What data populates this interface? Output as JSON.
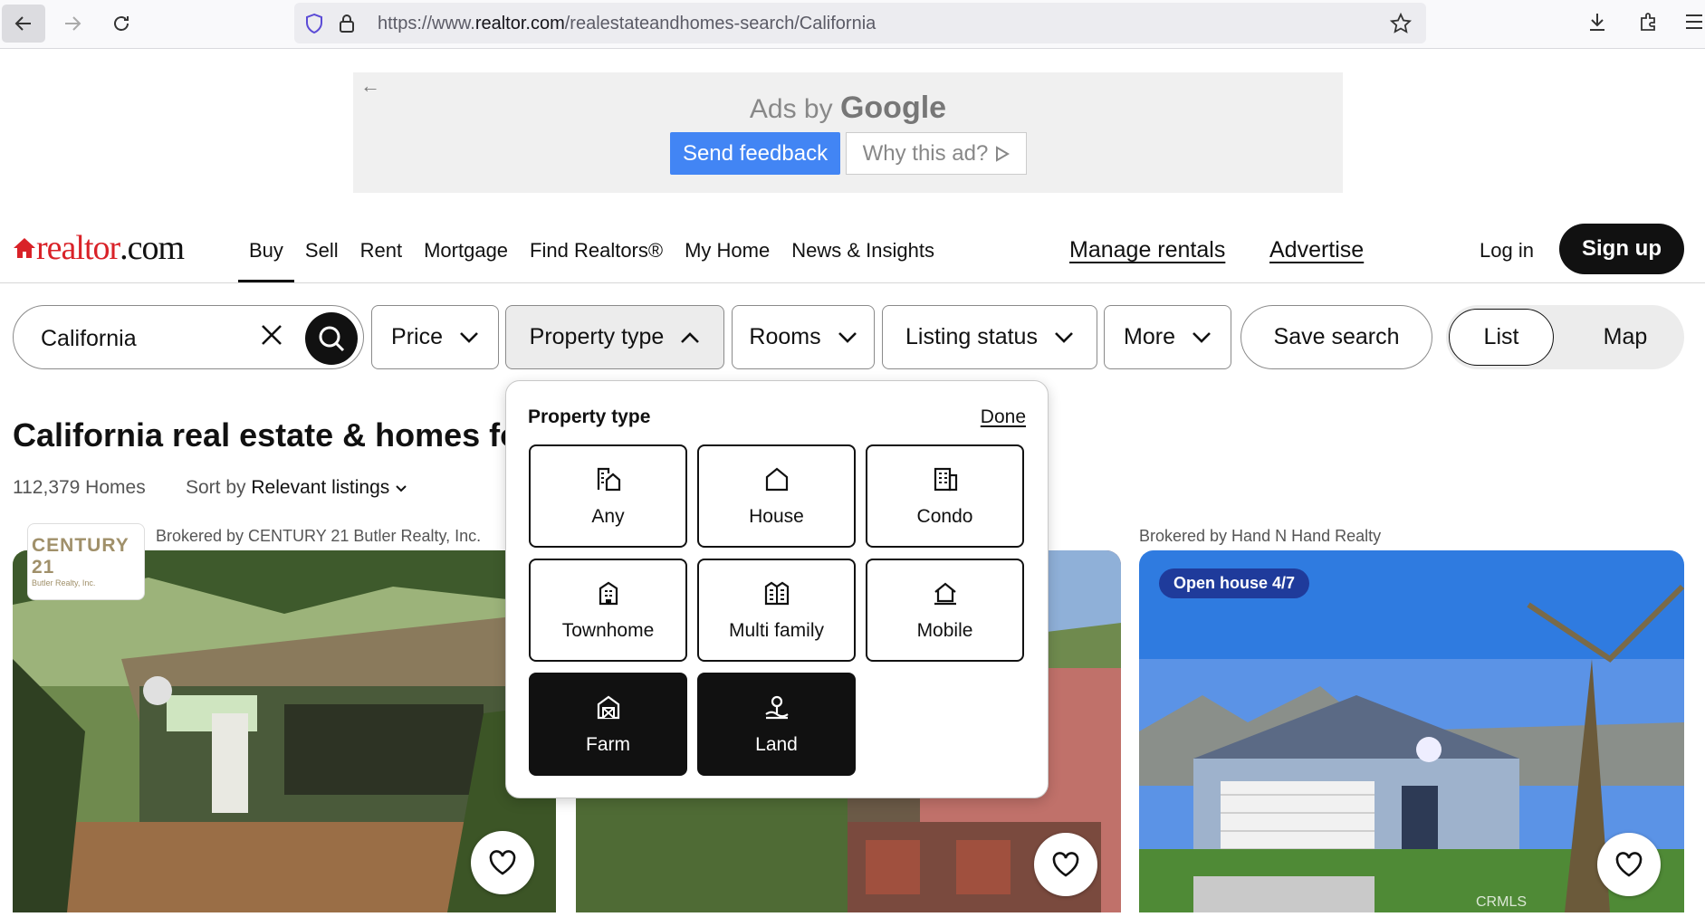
{
  "browser": {
    "url_prefix": "https://www.",
    "url_domain": "realtor.com",
    "url_path": "/realestateandhomes-search/California"
  },
  "ad": {
    "ads_by": "Ads by",
    "google": "Google",
    "feedback": "Send feedback",
    "why": "Why this ad?"
  },
  "header": {
    "logo_main": "realtor",
    "logo_com": ".com",
    "nav": [
      {
        "label": "Buy"
      },
      {
        "label": "Sell"
      },
      {
        "label": "Rent"
      },
      {
        "label": "Mortgage"
      },
      {
        "label": "Find Realtors®"
      },
      {
        "label": "My Home"
      },
      {
        "label": "News & Insights"
      }
    ],
    "manage_rentals": "Manage rentals",
    "advertise": "Advertise",
    "login": "Log in",
    "signup": "Sign up"
  },
  "filters": {
    "search_value": "California",
    "price": "Price",
    "property_type": "Property type",
    "rooms": "Rooms",
    "listing_status": "Listing status",
    "more": "More",
    "save_search": "Save search",
    "list": "List",
    "map": "Map"
  },
  "results": {
    "title": "California real estate & homes for sale",
    "count": "112,379 Homes",
    "sort_prefix": "Sort by",
    "sort_value": "Relevant listings"
  },
  "cards": [
    {
      "broker": "Brokered by CENTURY 21 Butler Realty, Inc.",
      "brand": "CENTURY 21",
      "brand_sub": "Butler Realty, Inc."
    },
    {
      "broker": ""
    },
    {
      "broker": "Brokered by Hand N Hand Realty",
      "badge": "Open house 4/7",
      "watermark": "CRMLS"
    }
  ],
  "property_dropdown": {
    "title": "Property type",
    "done": "Done",
    "options": [
      {
        "label": "Any",
        "icon": "any-icon",
        "selected": false
      },
      {
        "label": "House",
        "icon": "house-icon",
        "selected": false
      },
      {
        "label": "Condo",
        "icon": "condo-icon",
        "selected": false
      },
      {
        "label": "Townhome",
        "icon": "townhome-icon",
        "selected": false
      },
      {
        "label": "Multi family",
        "icon": "multi-family-icon",
        "selected": false
      },
      {
        "label": "Mobile",
        "icon": "mobile-icon",
        "selected": false
      },
      {
        "label": "Farm",
        "icon": "farm-icon",
        "selected": true
      },
      {
        "label": "Land",
        "icon": "land-icon",
        "selected": true
      }
    ]
  }
}
